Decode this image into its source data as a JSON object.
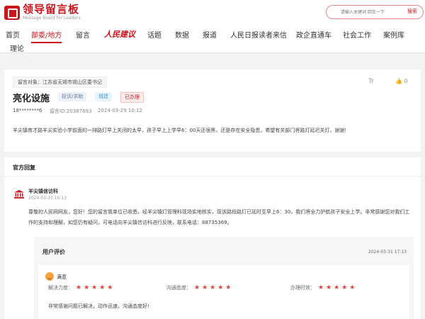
{
  "header": {
    "logo_cn": "领导留言板",
    "logo_en": "Message Board for Leaders",
    "search_placeholder": "请输入关键词 回车一下",
    "search_button": "搜索"
  },
  "nav": {
    "items": [
      "首页",
      "部委/地方",
      "留言",
      "人民建议",
      "话题",
      "数据",
      "报道",
      "人民日报读者来信",
      "政企直通车",
      "社会工作",
      "案例库",
      "理论"
    ],
    "active_index": 1
  },
  "message": {
    "target": "留言对象：江苏省无锡市锡山区委书记",
    "title": "亮化设施",
    "tags": {
      "type": "投诉/求助",
      "category": "城建",
      "status": "已办理"
    },
    "author": "18********6",
    "id": "留言ID:20387693",
    "time": "2024-03-29 10:12",
    "content": "羊尖镇育才路羊尖实验小学前面的一排路灯早上关闭的太早，孩子早上上学早6：00天还很黑，还是存在安全隐患，希望有关部门将路灯延迟关灯，谢谢!",
    "tr_label": "Tr",
    "likes": "0"
  },
  "official": {
    "section_title": "官方回复",
    "org": "羊尖镇信访科",
    "time": "2024-03-31 16:13",
    "reply": "尊敬的人民网网友，您好！您的留言我单位已收悉，经羊尖镇灯管理科现场实地核实，现该路段路灯已延时至早上6：30，我们将全力护航孩子安全上学。非常感谢您对我们工作的支持和理解，如您仍有疑问，可电话向羊尖镇信访科进行反映，联系电话：88735369。"
  },
  "evaluation": {
    "title": "用户评价",
    "time": "2024-03-31 17:13",
    "satisfaction": "满意",
    "ratings": [
      {
        "label": "解决力度：",
        "stars": 5
      },
      {
        "label": "沟通态度：",
        "stars": 5
      },
      {
        "label": "办理时效：",
        "stars": 5
      }
    ],
    "text": "非常感谢问题已解决，动作迅速，沟通态度好!"
  },
  "colors": {
    "brand": "#c8161d",
    "star": "#e2453c"
  }
}
